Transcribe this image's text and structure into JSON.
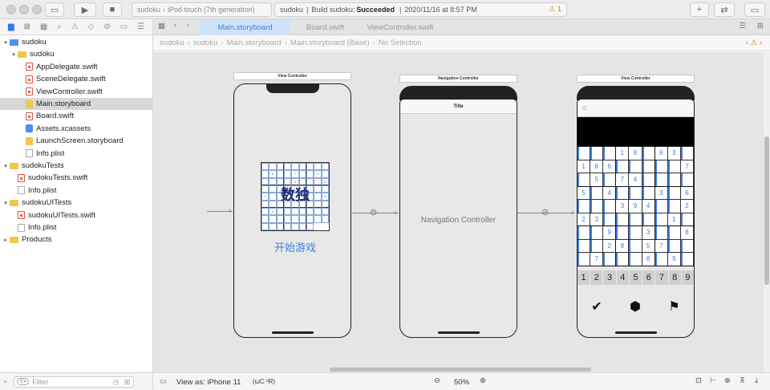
{
  "toolbar": {
    "scheme": "sudoku",
    "device": "iPod touch (7th generation)",
    "activity_project": "sudoku",
    "activity_status_prefix": "Build sudoku:",
    "activity_status": "Succeeded",
    "activity_time": "2020/11/16 at 8:57 PM",
    "warning_count": "1"
  },
  "navigator": {
    "items": [
      {
        "label": "sudoku",
        "kind": "project",
        "level": 0,
        "disclosure": "▾"
      },
      {
        "label": "sudoku",
        "kind": "folder",
        "level": 1,
        "disclosure": "▾"
      },
      {
        "label": "AppDelegate.swift",
        "kind": "swift",
        "level": 2
      },
      {
        "label": "SceneDelegate.swift",
        "kind": "swift",
        "level": 2
      },
      {
        "label": "ViewController.swift",
        "kind": "swift",
        "level": 2
      },
      {
        "label": "Main.storyboard",
        "kind": "storyboard",
        "level": 2,
        "selected": true
      },
      {
        "label": "Board.swift",
        "kind": "swift",
        "level": 2
      },
      {
        "label": "Assets.xcassets",
        "kind": "assets",
        "level": 2
      },
      {
        "label": "LaunchScreen.storyboard",
        "kind": "storyboard",
        "level": 2
      },
      {
        "label": "Info.plist",
        "kind": "plist",
        "level": 2
      },
      {
        "label": "sudokuTests",
        "kind": "folder",
        "level": 0,
        "disclosure": "▾"
      },
      {
        "label": "sudokuTests.swift",
        "kind": "swift",
        "level": 1
      },
      {
        "label": "Info.plist",
        "kind": "plist",
        "level": 1
      },
      {
        "label": "sudokuUITests",
        "kind": "folder",
        "level": 0,
        "disclosure": "▾"
      },
      {
        "label": "sudokuUITests.swift",
        "kind": "swift",
        "level": 1
      },
      {
        "label": "Info.plist",
        "kind": "plist",
        "level": 1
      },
      {
        "label": "Products",
        "kind": "folder",
        "level": 0,
        "disclosure": "▸"
      }
    ],
    "filter_placeholder": "Filter"
  },
  "tabs": [
    {
      "label": "Main.storyboard",
      "active": true
    },
    {
      "label": "Board.swift",
      "active": false
    },
    {
      "label": "ViewController.swift",
      "active": false
    }
  ],
  "breadcrumbs": [
    "sudoku",
    "sudoku",
    "Main.storyboard",
    "Main.storyboard (Base)",
    "No Selection"
  ],
  "scenes": {
    "vc1_title": "View Controller",
    "nav_title": "Navigation Controller",
    "vc2_title": "View Controller",
    "big_title": "数独",
    "start_button": "开始游戏",
    "nav_bar_title": "Title",
    "nav_label": "Navigation Controller"
  },
  "mini_grid": [
    "",
    "",
    "",
    "",
    "",
    "",
    "",
    "",
    "",
    "",
    "6",
    "",
    "",
    "7",
    "",
    "",
    "4",
    "",
    "",
    "",
    "",
    "",
    "4",
    "",
    "",
    "",
    "6",
    "",
    "",
    "",
    "",
    "",
    "",
    "",
    "",
    "",
    "2",
    "",
    "",
    "",
    "",
    "",
    "",
    "",
    "5",
    "",
    "",
    "",
    "",
    "",
    "",
    "",
    "",
    "",
    "",
    "5",
    "",
    "",
    "",
    "",
    "",
    "",
    "",
    "",
    "",
    "",
    "",
    "",
    "",
    "",
    "",
    "",
    "",
    "",
    "",
    "",
    "",
    "",
    ""
  ],
  "board": [
    [
      "",
      "",
      "",
      "1",
      "8",
      "",
      "9",
      "3",
      ""
    ],
    [
      "1",
      "8",
      "6",
      "",
      "",
      "",
      "",
      "",
      "7"
    ],
    [
      "",
      "5",
      "",
      "7",
      "4",
      "",
      "",
      "",
      ""
    ],
    [
      "5",
      "",
      "4",
      "",
      "",
      "",
      "3",
      "",
      "6"
    ],
    [
      "",
      "",
      "",
      "3",
      "9",
      "4",
      "",
      "",
      "2"
    ],
    [
      "2",
      "3",
      "",
      "",
      "",
      "",
      "",
      "1",
      ""
    ],
    [
      "",
      "",
      "9",
      "",
      "",
      "3",
      "",
      "",
      "8"
    ],
    [
      "",
      "",
      "2",
      "9",
      "",
      "5",
      "7",
      "",
      ""
    ],
    [
      "",
      "7",
      "",
      "",
      "",
      "8",
      "",
      "9",
      ""
    ]
  ],
  "numpad": [
    "1",
    "2",
    "3",
    "4",
    "5",
    "6",
    "7",
    "8",
    "9"
  ],
  "tool_icons": [
    "checkmark-icon",
    "eraser-icon",
    "flag-icon"
  ],
  "statusbar": {
    "view_as": "View as: iPhone 11",
    "view_as_suffix": "(ωC ˢR)",
    "zoom": "50%"
  }
}
